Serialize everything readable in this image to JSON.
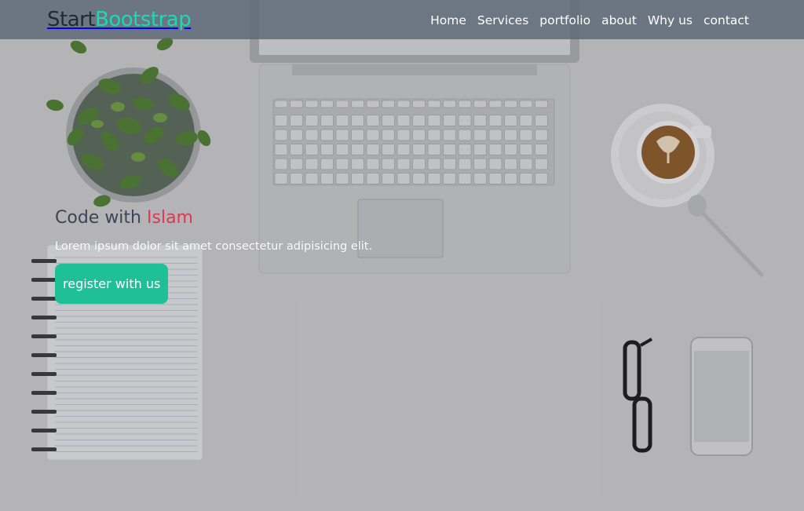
{
  "brand": {
    "part1": "Start",
    "part2": "Bootstrap"
  },
  "nav": {
    "items": [
      {
        "label": "Home"
      },
      {
        "label": "Services"
      },
      {
        "label": "portfolio"
      },
      {
        "label": "about"
      },
      {
        "label": "Why us"
      },
      {
        "label": "contact"
      }
    ]
  },
  "hero": {
    "title_part1": "Code with",
    "title_part2": "Islam",
    "text": "Lorem ipsum dolor sit amet consectetur adipisicing elit.",
    "cta_label": "register with us"
  },
  "colors": {
    "brand_accent": "#19d9b6",
    "title_accent": "#e0374f",
    "cta": "#1fbf97",
    "navbar": "#5c6876"
  }
}
